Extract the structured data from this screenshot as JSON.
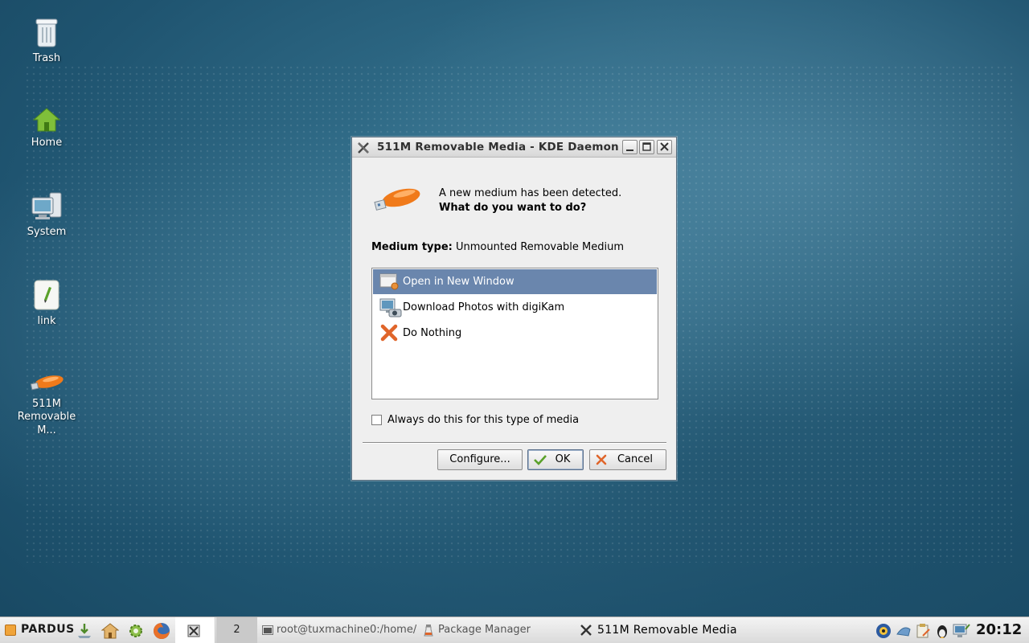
{
  "desktop": {
    "icons": [
      {
        "label": "Trash"
      },
      {
        "label": "Home"
      },
      {
        "label": "System"
      },
      {
        "label": "link"
      },
      {
        "label_line1": "511M",
        "label_line2": "Removable M..."
      }
    ]
  },
  "dialog": {
    "title": "511M Removable Media - KDE Daemon",
    "message_line1": "A new medium has been detected.",
    "message_line2": "What do you want to do?",
    "medium_type_label": "Medium type:",
    "medium_type_value": "Unmounted Removable Medium",
    "actions": [
      {
        "label": "Open in New Window",
        "selected": true
      },
      {
        "label": "Download Photos with digiKam",
        "selected": false
      },
      {
        "label": "Do Nothing",
        "selected": false
      }
    ],
    "always_checkbox": {
      "label": "Always do this for this type of media",
      "checked": false
    },
    "buttons": {
      "configure": "Configure...",
      "ok": "OK",
      "cancel": "Cancel"
    }
  },
  "taskbar": {
    "start_label": "PARDUS",
    "pager": {
      "current": "",
      "other": "2"
    },
    "tasks": [
      {
        "label": "root@tuxmachine0:/home/"
      },
      {
        "label": "Package Manager"
      },
      {
        "label": "511M Removable Media"
      }
    ],
    "clock": "20:12"
  },
  "colors": {
    "selection": "#6a86ad",
    "desktop": "#2f6a86",
    "usb_stick": "#f07a1a"
  }
}
